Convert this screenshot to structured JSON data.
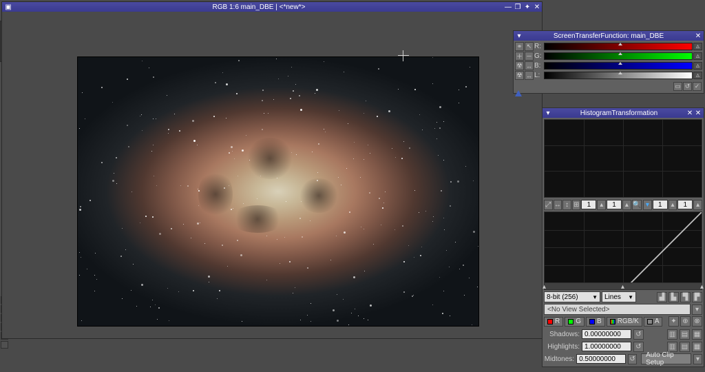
{
  "sidebar": {
    "tab_label": "main_DBE"
  },
  "image_window": {
    "title": "RGB 1:6 main_DBE | <*new*>",
    "buttons": {
      "min": "—",
      "restore": "❐",
      "max": "✦",
      "close": "✕"
    }
  },
  "stf": {
    "title": "ScreenTransferFunction: main_DBE",
    "channels": [
      {
        "label": "R:",
        "cls": "r"
      },
      {
        "label": "G:",
        "cls": "g"
      },
      {
        "label": "B:",
        "cls": "b"
      },
      {
        "label": "L:",
        "cls": "l"
      }
    ],
    "tools": [
      "link",
      "cursor",
      "zoom-in",
      "zoom-out",
      "nuke",
      "arrows"
    ]
  },
  "hist": {
    "title": "HistogramTransformation",
    "toolbar": {
      "zoom_x": "1",
      "zoom_y": "1",
      "pan_x": "1",
      "pan_y": "1"
    },
    "bit_depth": "8-bit (256)",
    "plot_mode": "Lines",
    "view": "<No View Selected>",
    "channels": {
      "r": "R",
      "g": "G",
      "b": "B",
      "rgbk": "RGB/K",
      "a": "A"
    },
    "params": {
      "shadows_label": "Shadows:",
      "shadows": "0.00000000",
      "highlights_label": "Highlights:",
      "highlights": "1.00000000",
      "midtones_label": "Midtones:",
      "midtones": "0.50000000"
    },
    "auto_clip": "Auto Clip Setup"
  }
}
